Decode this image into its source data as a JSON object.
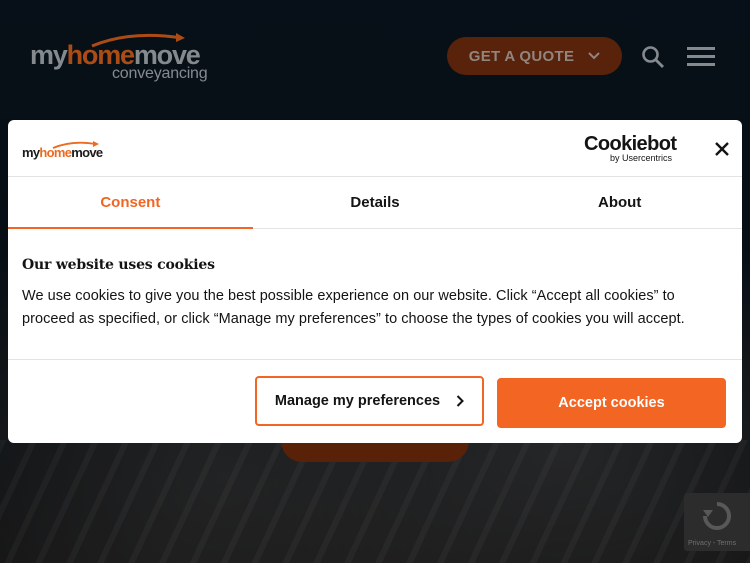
{
  "site": {
    "logo_main_pre": "my",
    "logo_main_accent": "home",
    "logo_main_post": "move",
    "logo_sub": "conveyancing",
    "quote_button": "GET A QUOTE",
    "recaptcha_text": "Privacy - Terms"
  },
  "dialog": {
    "logo_pre": "my",
    "logo_accent": "home",
    "logo_post": "move",
    "cookiebot_name": "Cookiebot",
    "cookiebot_sub": "by Usercentrics",
    "tabs": [
      {
        "label": "Consent"
      },
      {
        "label": "Details"
      },
      {
        "label": "About"
      }
    ],
    "title": "Our website uses cookies",
    "text": "We use cookies to give you the best possible experience on our website. Click “Accept all cookies” to proceed as specified, or click “Manage my preferences” to choose the types of cookies you will accept.",
    "manage_button": "Manage my preferences",
    "accept_button": "Accept cookies"
  },
  "colors": {
    "accent": "#f26522",
    "background": "#0d1620"
  }
}
